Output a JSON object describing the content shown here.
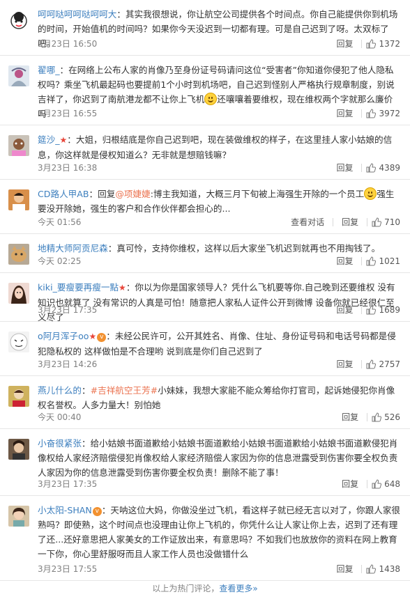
{
  "comments": [
    {
      "user": "呵呵哒呵呵哒呵呵大",
      "text": "：其实我很想说，你让航空公司提供各个时间点。你自己能提供你到机场的时间，开始值机的时间吗？如果你今天没迟到一切都有理。可是自己迟到了呀。太双标了吧。",
      "time": "3月23日 16:50",
      "reply": "回复",
      "likes": "1372"
    },
    {
      "user": "翟哪_",
      "text": "：在网络上公布人家的肖像乃至身份证号码请问这位“受害者”你知道你侵犯了他人隐私权吗？乘坐飞机最起码也要提前1个小时到机场吧，自己迟到怪别人严格执行规章制度，别说吉祥了，你迟到了南航港龙都不让你上飞机",
      "text2": "还嚷嚷着要维权，现在维权两个字就那么廉价吗",
      "time": "3月23日 16:55",
      "reply": "回复",
      "likes": "3972"
    },
    {
      "user": "筵沙_",
      "text": "：大姐，归根结底是你自己迟到吧，现在装做维权的样子，在这里挂人家小姑娘的信息，你这样就是侵权知道么？无非就是想赔钱嘛？",
      "time": "3月23日 16:38",
      "reply": "回复",
      "likes": "4389"
    },
    {
      "user": "CD路人甲AB",
      "prefix": "：回复",
      "mention": "@项婕婕",
      "text": ":博主我知道，大概三月下旬被上海强生开除的一个员工",
      "text2": "强生要没开除她，强生的客户和合作伙伴都会担心的...",
      "time": "今天 01:56",
      "view": "查看对话",
      "reply": "回复",
      "likes": "710"
    },
    {
      "user": "地精大师阿贡尼森",
      "text": "：真可怜，支持你维权，这样以后大家坐飞机迟到就再也不用掏钱了。",
      "time": "今天 02:25",
      "reply": "回复",
      "likes": "1021"
    },
    {
      "user": "kiki_要瘦要再瘦一點",
      "text": "：你以为你是国家领导人？凭什么飞机要等你.自己晚到还要维权 没有知识也就算了 没有常识的人真是可怕！随意把人家私人证件公开到微博 设备你就已经很仁至义尽了",
      "time": "3月23日 17:35",
      "reply": "回复",
      "likes": "1689"
    },
    {
      "user": "o阿月浑子oo",
      "text": "：未经公民许可，公开其姓名、肖像、住址、身份证号码和电话号码都是侵犯隐私权的 这样做怕是不合理哟 说到底是你们自己迟到了",
      "time": "3月23日 14:26",
      "reply": "回复",
      "likes": "2757"
    },
    {
      "user": "燕儿什么的",
      "prefix": "：",
      "hashtag": "#吉祥航空王芳#",
      "text": "小妹妹，我想大家能不能众筹给你打官司，起诉她侵犯你肖像权名誉权。人多力量大！别怕她",
      "time": "今天 00:40",
      "reply": "回复",
      "likes": "526"
    },
    {
      "user": "小奋很紧张",
      "text": "：给小姑娘书面道歉给小姑娘书面道歉给小姑娘书面道歉给小姑娘书面道歉侵犯肖像权给人家经济赔偿侵犯肖像权给人家经济赔偿人家因为你的信息泄露受到伤害你要全权负责人家因为你的信息泄露受到伤害你要全权负责！删除不能了事！",
      "time": "3月23日 17:35",
      "reply": "回复",
      "likes": "648"
    },
    {
      "user": "小太阳-SHAN",
      "text": "：天呐这位大妈，你做没坐过飞机，看这样子就已经无言以对了，你跟人家很熟吗？即使熟，这个时间点也没理由让你上飞机的，你凭什么让人家让你上去，迟到了还有理了还...还好意思把人家美女的工作证放出来，有意思吗？不如我们也放放你的资料在网上教育一下你，你心里舒服呀而且人家工作人员也没做错什么",
      "time": "3月23日 17:55",
      "reply": "回复",
      "likes": "1438"
    }
  ],
  "bottom": {
    "text": "以上为热门评论，",
    "more": "查看更多»"
  },
  "colors": {
    "accent": "#eb7350",
    "link": "#3d7fbe",
    "gray": "#808080"
  }
}
